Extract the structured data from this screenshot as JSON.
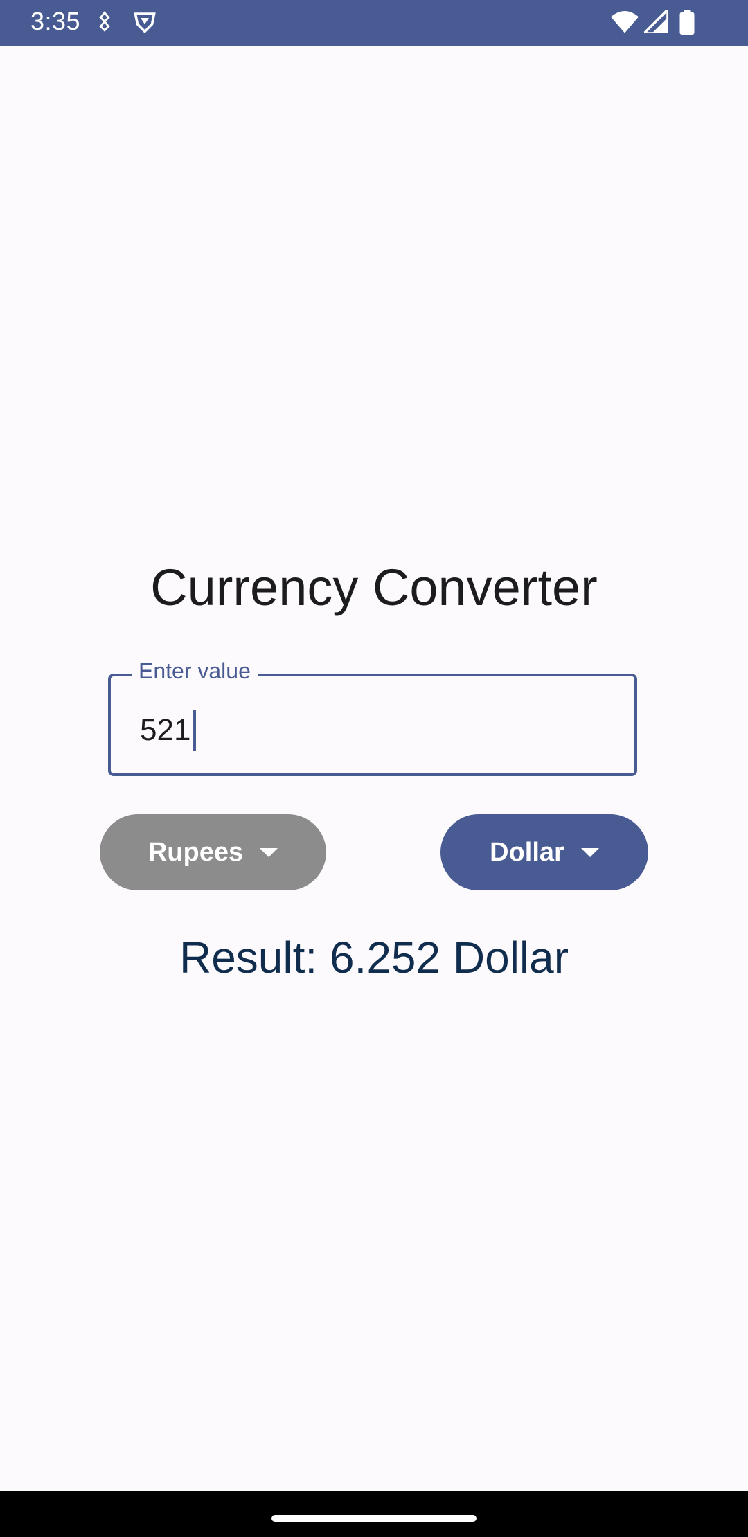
{
  "status_bar": {
    "time": "3:35",
    "icons": [
      "notification-icon",
      "vpn-shield-icon",
      "wifi-icon",
      "cellular-signal-icon",
      "battery-icon"
    ]
  },
  "app": {
    "title": "Currency Converter",
    "input": {
      "label": "Enter value",
      "value": "521"
    },
    "from_currency": {
      "selected": "Rupees",
      "color": "#8c8c8c"
    },
    "to_currency": {
      "selected": "Dollar",
      "color": "#485b92"
    },
    "result": "Result: 6.252 Dollar"
  },
  "colors": {
    "primary": "#485b92",
    "background": "#fdfafd",
    "result_text": "#112d4e"
  }
}
